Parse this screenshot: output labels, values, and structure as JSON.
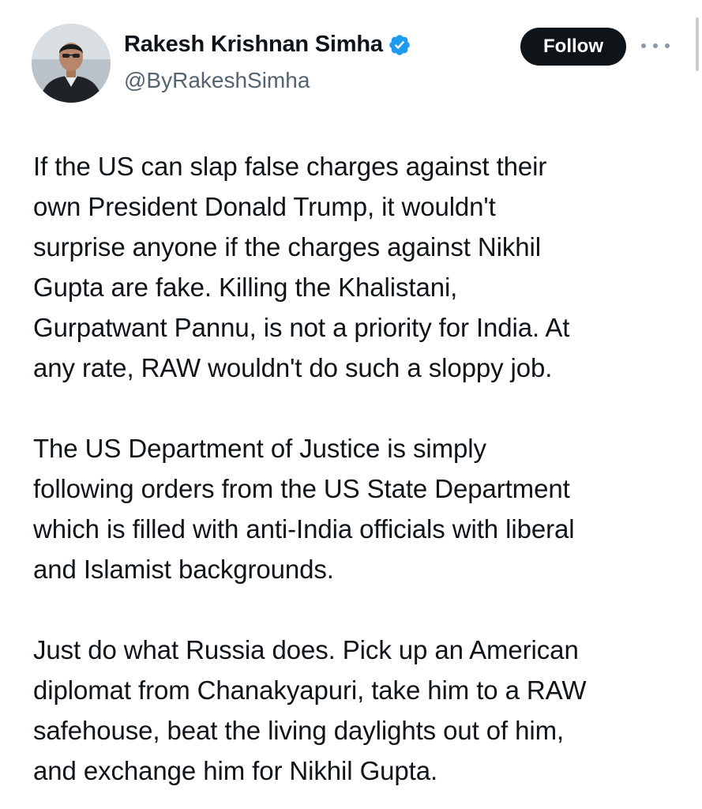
{
  "author": {
    "display_name": "Rakesh Krishnan Simha",
    "handle": "@ByRakeshSimha",
    "verified": true
  },
  "actions": {
    "follow_label": "Follow"
  },
  "icons": {
    "verified": "verified-badge-icon",
    "more": "more-options-icon"
  },
  "colors": {
    "verified_blue": "#1d9bf0",
    "follow_bg": "#0f1419",
    "text": "#0f1419",
    "secondary_text": "#536471"
  },
  "tweet": {
    "paragraphs": [
      "If the US can slap false charges against their\nown President Donald Trump, it wouldn't\nsurprise anyone if the charges against Nikhil\nGupta are fake. Killing the Khalistani,\nGurpatwant Pannu, is not a priority for India. At\nany rate, RAW wouldn't do such a sloppy job.",
      "The US Department of Justice is simply\nfollowing orders from the US State Department\nwhich is filled with anti-India officials with liberal\nand Islamist backgrounds.",
      "Just do what Russia does. Pick up an American\ndiplomat from Chanakyapuri, take him to a RAW\nsafehouse, beat the living daylights out of him,\nand exchange him for Nikhil Gupta."
    ]
  }
}
